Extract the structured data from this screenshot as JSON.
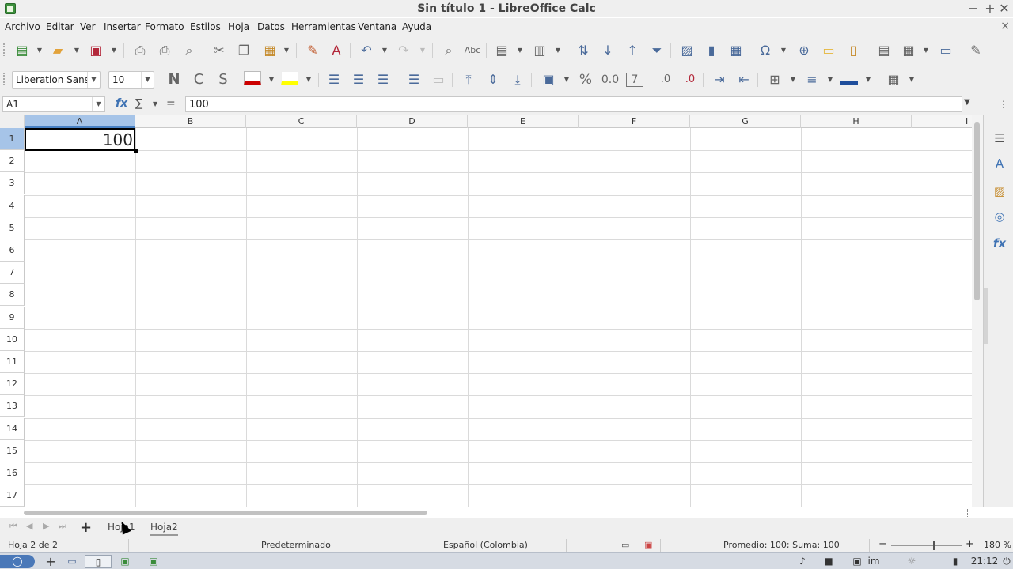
{
  "window": {
    "title": "Sin título 1 - LibreOffice Calc",
    "minimize": "−",
    "maximize": "+",
    "close": "✕"
  },
  "menu": [
    "Archivo",
    "Editar",
    "Ver",
    "Insertar",
    "Formato",
    "Estilos",
    "Hoja",
    "Datos",
    "Herramientas",
    "Ventana",
    "Ayuda"
  ],
  "menu_close": "×",
  "format": {
    "font_name": "Liberation Sans",
    "font_size": "10"
  },
  "format_icons": {
    "bold": "N",
    "italic": "C",
    "underline": "S",
    "percent": "%",
    "number": "0.0",
    "date": "7"
  },
  "colors": {
    "font_color": "#cc0000",
    "highlight": "#ffff00",
    "border_color": "#1f4e9c",
    "selection": "#a6c4e8"
  },
  "formula_bar": {
    "name_box": "A1",
    "fx": "fx",
    "sum": "∑",
    "equals": "=",
    "content": "100"
  },
  "sheet": {
    "columns": [
      "A",
      "B",
      "C",
      "D",
      "E",
      "F",
      "G",
      "H",
      "I"
    ],
    "rows": [
      "1",
      "2",
      "3",
      "4",
      "5",
      "6",
      "7",
      "8",
      "9",
      "10",
      "11",
      "12",
      "13",
      "14",
      "15",
      "16",
      "17"
    ],
    "cells": {
      "A1": "100"
    }
  },
  "sheet_tabs": [
    "Hoja1",
    "Hoja2"
  ],
  "status": {
    "sheet_position": "Hoja 2 de 2",
    "page_style": "Predeterminado",
    "language": "Español (Colombia)",
    "selection_summary": "Promedio: 100; Suma: 100",
    "zoom": "180 %"
  },
  "taskbar": {
    "clock": "21:12",
    "ime": "im"
  }
}
